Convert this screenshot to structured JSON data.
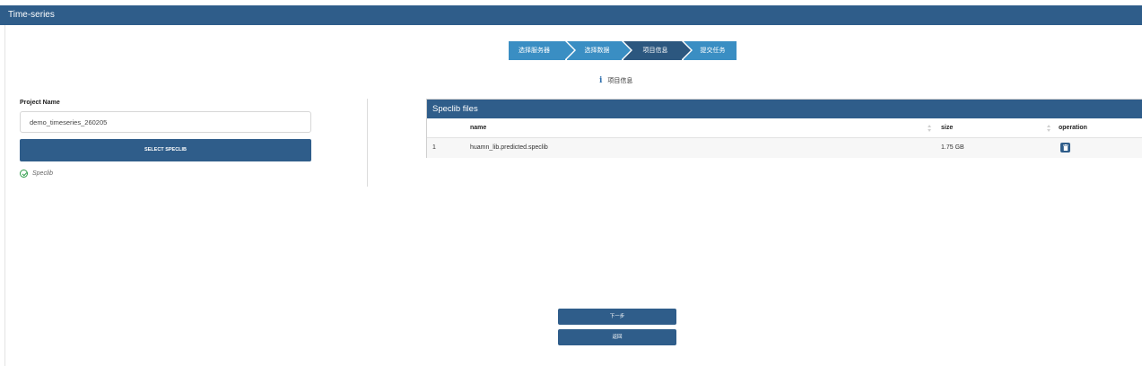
{
  "window": {
    "title": "Time-series"
  },
  "steps": [
    {
      "label": "选择服务器",
      "active": false
    },
    {
      "label": "选择数据",
      "active": false
    },
    {
      "label": "项目信息",
      "active": true
    },
    {
      "label": "提交任务",
      "active": false
    }
  ],
  "step_info": {
    "icon": "info-icon",
    "text": "项目信息"
  },
  "project": {
    "label": "Project Name",
    "value": "demo_timeseries_260205",
    "select_button": "SELECT SPECLIB",
    "status_text": "Speclib",
    "status_icon": "check-circle-icon",
    "status_color": "#2e9d4a"
  },
  "speclib_panel": {
    "title": "Speclib files",
    "columns": [
      "name",
      "size",
      "operation"
    ],
    "rows": [
      {
        "index": "1",
        "name": "huamn_lib.predicted.speclib",
        "size": "1.75 GB",
        "operation_icon": "trash-icon"
      }
    ]
  },
  "actions": {
    "next": "下一步",
    "back": "返回"
  },
  "colors": {
    "primary": "#2f5d8a",
    "step": "#3a8ec3",
    "step_active": "#2c577f"
  }
}
